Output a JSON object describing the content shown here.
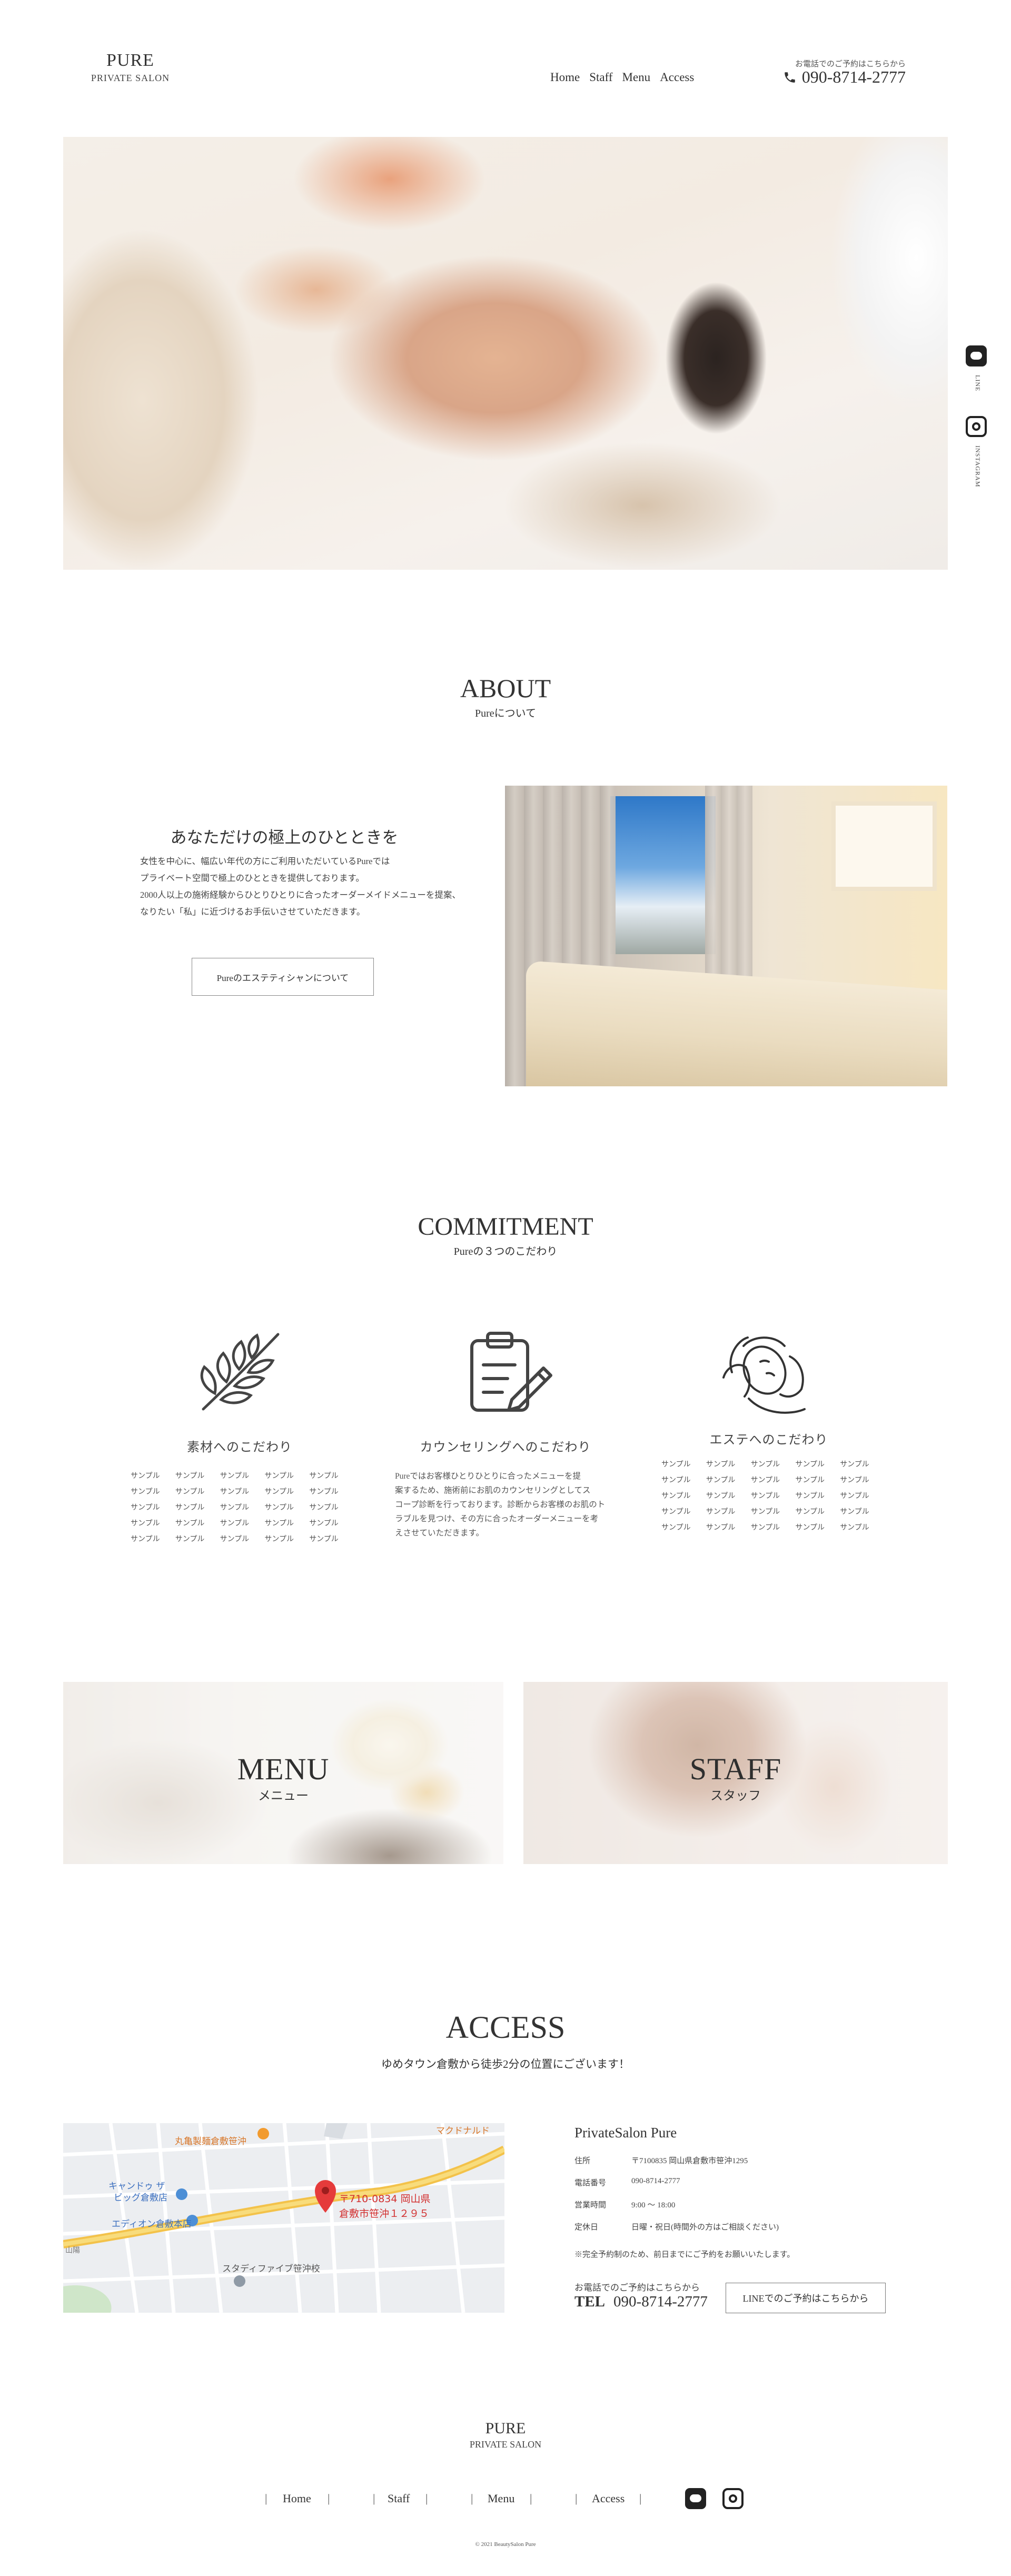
{
  "header": {
    "logo": "PURE",
    "logo_sub": "PRIVATE  SALON",
    "nav": [
      "Home",
      "Staff",
      "Menu",
      "Access"
    ],
    "phone_note": "お電話でのご予約はこちらから",
    "phone": "090-8714-2777"
  },
  "side": {
    "line_label": "LINE",
    "instagram_label": "INSTAGRAM"
  },
  "about": {
    "title": "ABOUT",
    "subtitle": "Pureについて",
    "heading": "あなただけの極上のひとときを",
    "lines": [
      "女性を中心に、幅広い年代の方にご利用いただいているPureでは",
      "プライベート空間で極上のひとときを提供しております。",
      "2000人以上の施術経験からひとりひとりに合ったオーダーメイドメニューを提案、",
      "なりたい「私」に近づけるお手伝いさせていただきます。"
    ],
    "button": "Pureのエステティシャンについて"
  },
  "commitment": {
    "title": "COMMITMENT",
    "subtitle": "Pureの３つのこだわり",
    "items": [
      {
        "icon": "leaf-icon",
        "title": "素材へのこだわり"
      },
      {
        "icon": "clipboard-icon",
        "title": "カウンセリングへのこだわり"
      },
      {
        "icon": "facial-care-icon",
        "title": "エステへのこだわり"
      }
    ],
    "sample_word": "サンプル",
    "counseling_lines": [
      "Pureではお客様ひとりひとりに合ったメニューを提",
      "案するため、施術前にお肌のカウンセリングとしてス",
      "コープ診断を行っております。診断からお客様のお肌のト",
      "ラブルを見つけ、その方に合ったオーダーメニューを考",
      "えさせていただきます。"
    ]
  },
  "tiles": {
    "menu": {
      "title": "MENU",
      "sub": "メニュー"
    },
    "staff": {
      "title": "STAFF",
      "sub": "スタッフ"
    }
  },
  "access": {
    "title": "ACCESS",
    "subtitle": "ゆめタウン倉敷から徒歩2分の位置にございます！",
    "map": {
      "labels": [
        "丸亀製麺倉敷笹沖",
        "マクドナルド",
        "キャンドゥ ザ",
        "ビッグ倉敷店",
        "エディオン倉敷本店",
        "〒710-0834 岡山県",
        "倉敷市笹沖１２９５",
        "スタディファイブ笹沖校",
        "山陽"
      ]
    },
    "salon_name": "PrivateSalon  Pure",
    "rows": [
      {
        "k": "住所",
        "v": "〒7100835 岡山県倉敷市笹沖1295"
      },
      {
        "k": "電話番号",
        "v": "090-8714-2777"
      },
      {
        "k": "営業時間",
        "v": "9:00  〜  18:00"
      },
      {
        "k": "定休日",
        "v": "日曜・祝日(時間外の方はご相談ください)"
      }
    ],
    "note": "※完全予約制のため、前日までにご予約をお願いいたします。",
    "tel_note": "お電話でのご予約はこちらから",
    "tel_label": "TEL",
    "tel": "090-8714-2777",
    "line_button": "LINEでのご予約はこちらから"
  },
  "footer": {
    "logo": "PURE",
    "logo_sub": "PRIVATE  SALON",
    "nav": [
      "Home",
      "Staff",
      "Menu",
      "Access"
    ],
    "copyright": "© 2021  BeautySalon Pure"
  }
}
